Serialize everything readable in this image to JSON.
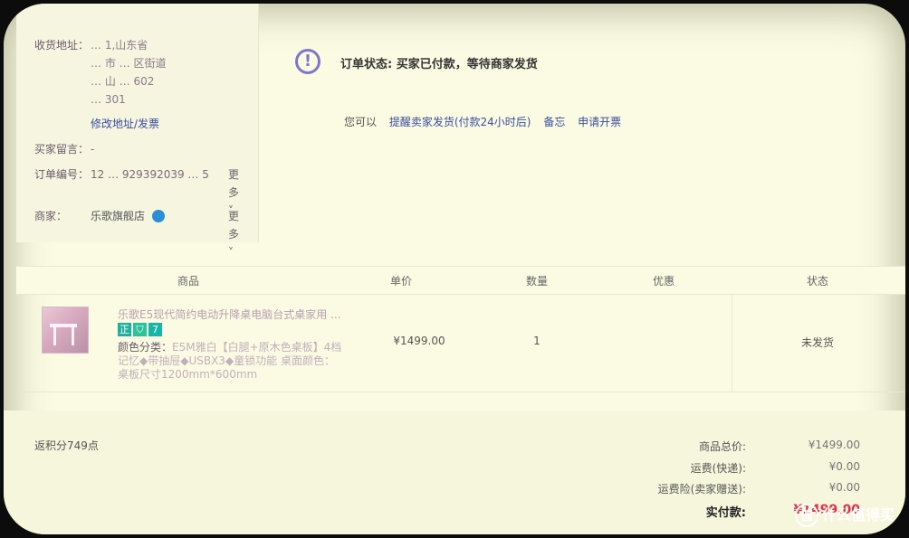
{
  "order_info": {
    "address_label": "收货地址：",
    "address_lines": [
      "… 1,山东省",
      "… 市 … 区街道",
      "… 山 … 602",
      "… 301"
    ],
    "edit_link": "修改地址/发票",
    "message_label": "买家留言：",
    "message_value": "-",
    "order_no_label": "订单编号：",
    "order_no_value": "12 … 929392039 … 5",
    "more_label": "更多",
    "seller_label": "商家：",
    "seller_value": "乐歌旗舰店"
  },
  "status": {
    "label": "订单状态:",
    "value": "买家已付款，等待商家发货",
    "actions_prefix": "您可以",
    "action_remind": "提醒卖家发货(付款24小时后)",
    "action_note": "备忘",
    "action_invoice": "申请开票"
  },
  "table": {
    "headers": [
      "商品",
      "单价",
      "数量",
      "优惠",
      "状态"
    ],
    "product": {
      "name": "乐歌E5现代简约电动升降桌电脑台式桌家用 ...",
      "badges": [
        "正",
        "",
        "7"
      ],
      "desc_prefix": "颜色分类：",
      "desc": "E5M雅白【白腿+原木色桌板】4档记忆◆带抽屉◆USBX3◆童锁功能 桌面颜色：桌板尺寸1200mm*600mm",
      "price": "¥1499.00",
      "qty": "1",
      "status": "未发货"
    }
  },
  "summary": {
    "points": "返积分749点",
    "goods_total_label": "商品总价:",
    "goods_total_value": "¥1499.00",
    "shipping_label": "运费(快递):",
    "shipping_value": "¥0.00",
    "insurance_label": "运费险(卖家赠送):",
    "insurance_value": "¥0.00",
    "paid_label": "实付款:",
    "paid_value": "¥1499.00"
  },
  "watermark": "什么值得买",
  "watermark_icon": "值"
}
